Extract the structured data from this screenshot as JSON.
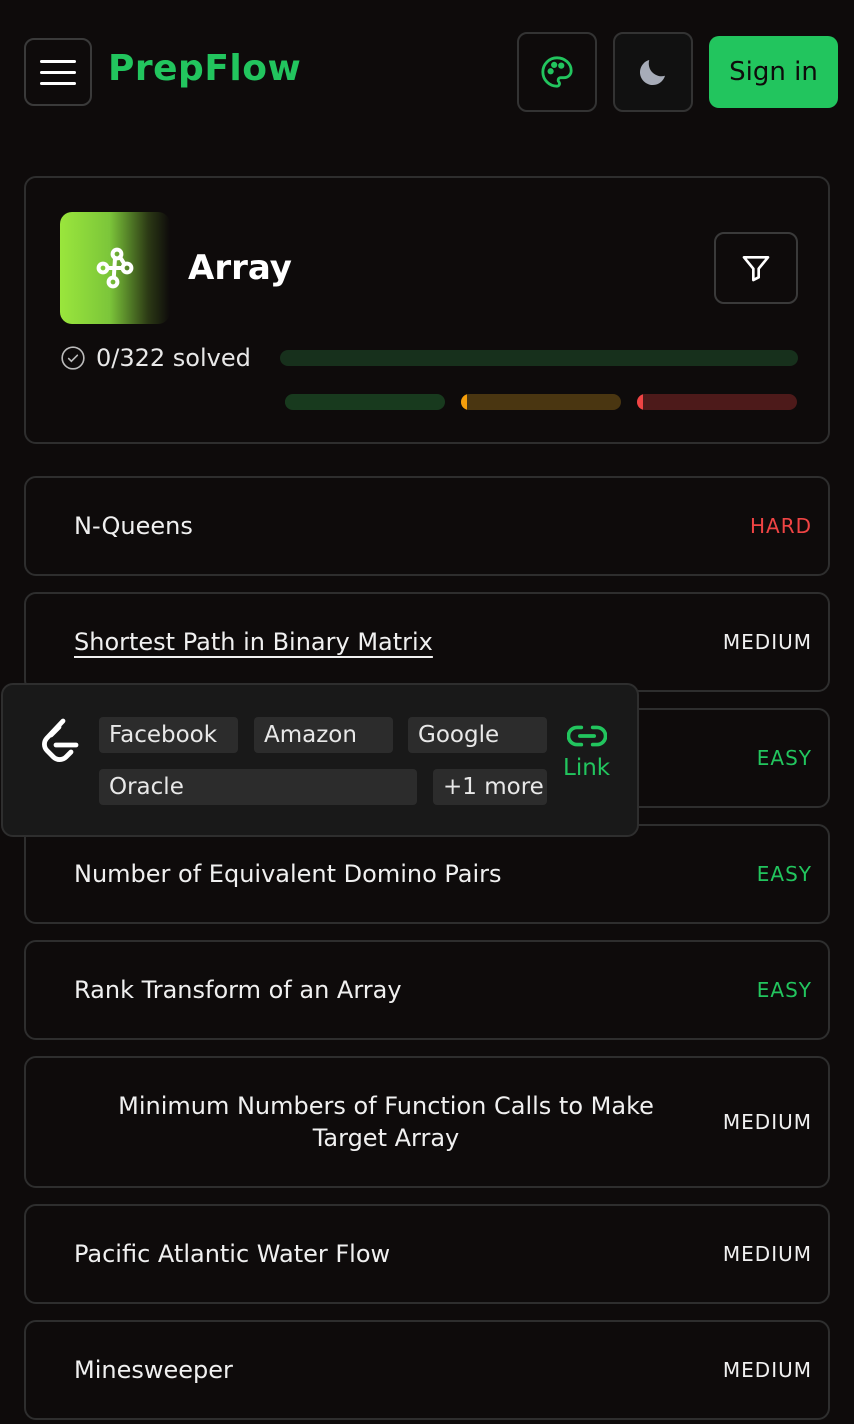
{
  "header": {
    "brand": "PrepFlow",
    "sign_in_label": "Sign in"
  },
  "topic": {
    "title": "Array",
    "solved": 0,
    "total": 322,
    "solved_text": "0/322 solved",
    "progress_fraction": 0,
    "difficulty_progress": {
      "easy": 0,
      "medium": 0,
      "hard": 0
    }
  },
  "problems": [
    {
      "name": "N-Queens",
      "difficulty": "HARD"
    },
    {
      "name": "Shortest Path in Binary Matrix",
      "difficulty": "MEDIUM"
    },
    {
      "name": "",
      "difficulty": "EASY"
    },
    {
      "name": "Number of Equivalent Domino Pairs",
      "difficulty": "EASY"
    },
    {
      "name": "Rank Transform of an Array",
      "difficulty": "EASY"
    },
    {
      "name": "Minimum Numbers of Function Calls to Make Target Array",
      "difficulty": "MEDIUM"
    },
    {
      "name": "Pacific Atlantic Water Flow",
      "difficulty": "MEDIUM"
    },
    {
      "name": "Minesweeper",
      "difficulty": "MEDIUM"
    }
  ],
  "popover": {
    "companies": [
      "Facebook",
      "Amazon",
      "Google",
      "Oracle"
    ],
    "more": "+1 more",
    "link_label": "Link"
  },
  "colors": {
    "accent": "#22c55e",
    "easy": "#22c55e",
    "medium": "#f59e0b",
    "hard": "#ef4444",
    "background": "#0e0b0b"
  },
  "icons": {
    "menu": "hamburger-icon",
    "palette": "palette-icon",
    "theme": "moon-icon",
    "filter": "filter-icon",
    "topic": "graph-nodes-icon",
    "solved": "check-circle-icon",
    "platform": "leetcode-icon",
    "link": "link-icon"
  }
}
